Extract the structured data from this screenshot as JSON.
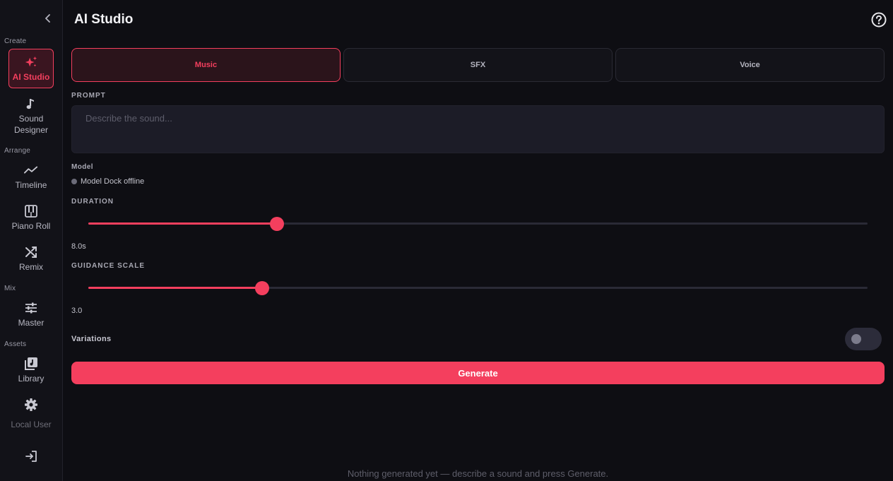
{
  "sidebar": {
    "sections": {
      "create": "Create",
      "arrange": "Arrange",
      "mix": "Mix",
      "assets": "Assets"
    },
    "items": [
      {
        "label": "AI Studio",
        "icon": "sparkles-icon",
        "active": true
      },
      {
        "label": "Sound Designer",
        "icon": "music-note-icon"
      },
      {
        "label": "Timeline",
        "icon": "trend-line-icon"
      },
      {
        "label": "Piano Roll",
        "icon": "piano-icon"
      },
      {
        "label": "Remix",
        "icon": "shuffle-icon"
      },
      {
        "label": "Master",
        "icon": "sliders-icon"
      },
      {
        "label": "Library",
        "icon": "library-icon"
      },
      {
        "label": "Local User",
        "icon": "gear-icon"
      }
    ],
    "logout_icon": "sign-in-icon",
    "collapse_icon": "chevron-left-icon"
  },
  "header": {
    "title": "AI Studio",
    "help_icon": "question-circle-icon"
  },
  "tabs": [
    {
      "label": "Music",
      "active": true
    },
    {
      "label": "SFX",
      "active": false
    },
    {
      "label": "Voice",
      "active": false
    }
  ],
  "prompt": {
    "label": "PROMPT",
    "placeholder": "Describe the sound...",
    "value": ""
  },
  "model": {
    "label": "Model",
    "status": "Model Dock offline"
  },
  "duration": {
    "label": "DURATION",
    "value_text": "8.0s",
    "fraction": 0.242
  },
  "guidance": {
    "label": "GUIDANCE SCALE",
    "value_text": "3.0",
    "fraction": 0.223
  },
  "variations": {
    "label": "Variations",
    "enabled": false
  },
  "generate": {
    "label": "Generate"
  },
  "empty_state": "Nothing generated yet — describe a sound and press Generate.",
  "colors": {
    "accent": "#f43f5e",
    "background": "#0e0e13",
    "sidebar": "#121218",
    "input": "#1c1c27"
  }
}
